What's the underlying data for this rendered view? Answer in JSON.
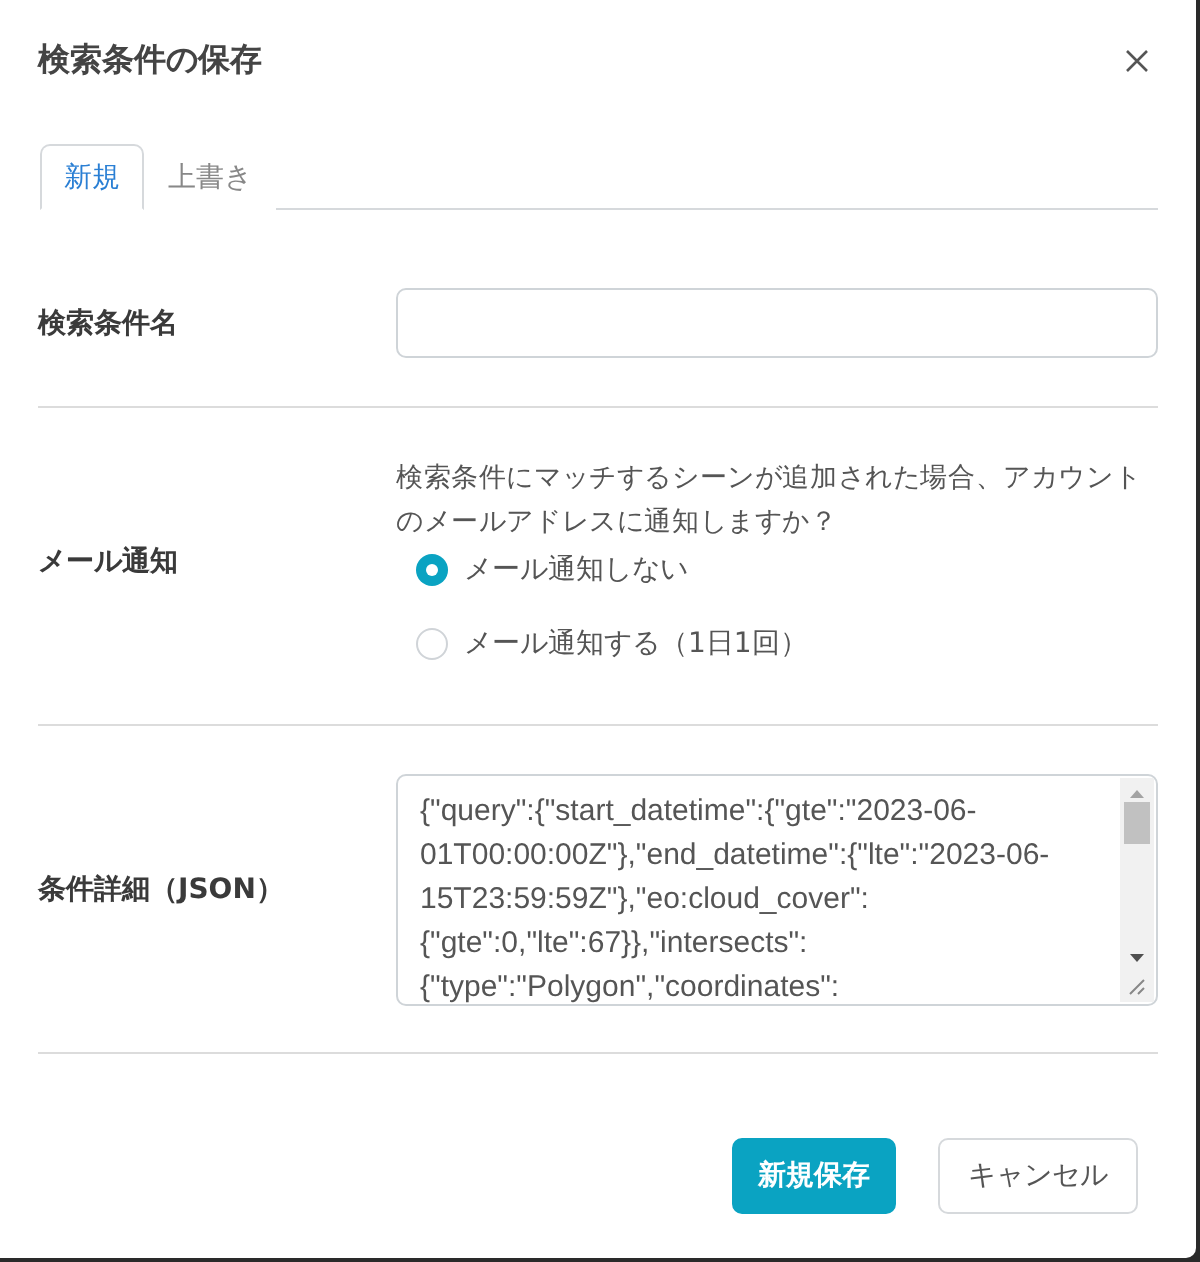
{
  "dialog": {
    "title": "検索条件の保存"
  },
  "tabs": [
    {
      "label": "新規",
      "selected": true
    },
    {
      "label": "上書き",
      "selected": false
    }
  ],
  "form": {
    "rows": [
      {
        "kind": "text",
        "label": "検索条件名"
      },
      {
        "kind": "radio",
        "label": "メール通知",
        "description": "検索条件にマッチするシーンが追加された場合、アカウントのメールアドレスに通知しますか？",
        "options": [
          {
            "label": "メール通知しない",
            "selected": true
          },
          {
            "label": "メール通知する（1日1回）",
            "selected": false
          }
        ]
      },
      {
        "kind": "textarea",
        "label": "条件詳細（JSON）",
        "value": "{\"query\":{\"start_datetime\":{\"gte\":\"2023-06-01T00:00:00Z\"},\"end_datetime\":{\"lte\":\"2023-06-15T23:59:59Z\"},\"eo:cloud_cover\":{\"gte\":0,\"lte\":67}},\"intersects\":{\"type\":\"Polygon\",\"coordinates\":"
      }
    ]
  },
  "buttons": [
    {
      "label": "新規保存",
      "kind": "primary"
    },
    {
      "label": "キャンセル",
      "kind": "secondary"
    }
  ]
}
